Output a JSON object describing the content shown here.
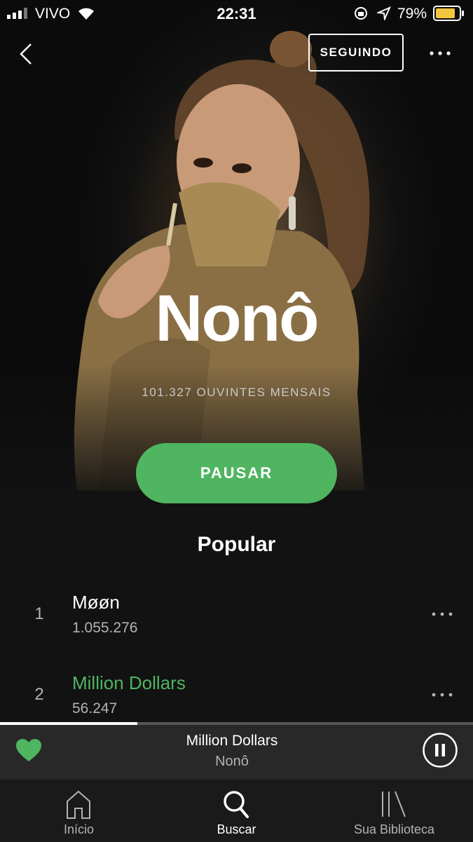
{
  "status_bar": {
    "carrier": "VIVO",
    "time": "22:31",
    "battery_percent": "79%",
    "icons": [
      "signal-icon",
      "wifi-icon",
      "rotation-lock-icon",
      "location-icon",
      "battery-icon"
    ]
  },
  "header": {
    "follow_label": "SEGUINDO"
  },
  "artist": {
    "name": "Nonô",
    "monthly_listeners": "101.327 OUVINTES MENSAIS"
  },
  "play_button": {
    "label": "PAUSAR"
  },
  "popular": {
    "title": "Popular",
    "tracks": [
      {
        "number": "1",
        "title": "Møøn",
        "plays": "1.055.276",
        "playing": false
      },
      {
        "number": "2",
        "title": "Million Dollars",
        "plays": "56.247",
        "playing": true
      }
    ]
  },
  "now_playing": {
    "title": "Million Dollars",
    "artist": "Nonô",
    "progress": 0.29,
    "liked": true
  },
  "tabs": [
    {
      "label": "Início",
      "icon": "home-icon",
      "active": false
    },
    {
      "label": "Buscar",
      "icon": "search-icon",
      "active": true
    },
    {
      "label": "Sua Biblioteca",
      "icon": "library-icon",
      "active": false
    }
  ],
  "colors": {
    "accent_green": "#4fb560",
    "background": "#121212",
    "now_playing_bar": "#282828",
    "tab_bar": "#1a1a1a"
  }
}
